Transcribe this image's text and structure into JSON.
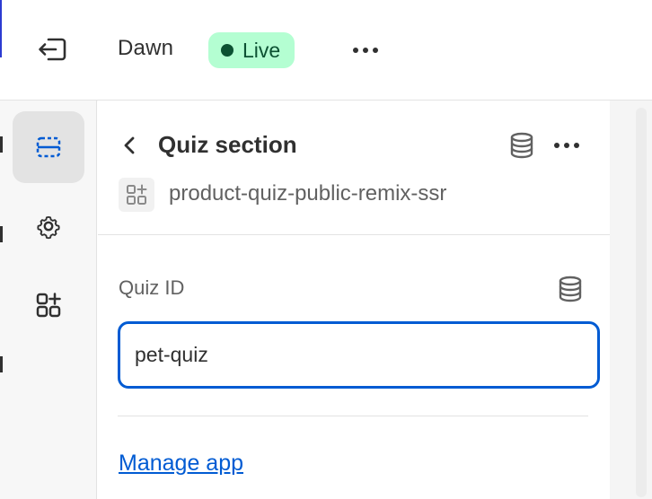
{
  "topbar": {
    "theme_name": "Dawn",
    "status_badge": "Live",
    "exit_icon": "exit-icon",
    "more_icon": "more-horizontal-icon"
  },
  "sidebar": {
    "items": [
      {
        "name": "sections",
        "icon": "layout-sections-icon",
        "active": true
      },
      {
        "name": "settings",
        "icon": "gear-icon",
        "active": false
      },
      {
        "name": "apps",
        "icon": "apps-add-icon",
        "active": false
      }
    ]
  },
  "section": {
    "title": "Quiz section",
    "app_name": "product-quiz-public-remix-ssr",
    "field": {
      "label": "Quiz ID",
      "value": "pet-quiz"
    },
    "manage_link": "Manage app"
  },
  "colors": {
    "accent": "#005bd3",
    "live_bg": "#b4fed2",
    "live_fg": "#0c5132",
    "text": "#303030",
    "muted": "#616161"
  }
}
